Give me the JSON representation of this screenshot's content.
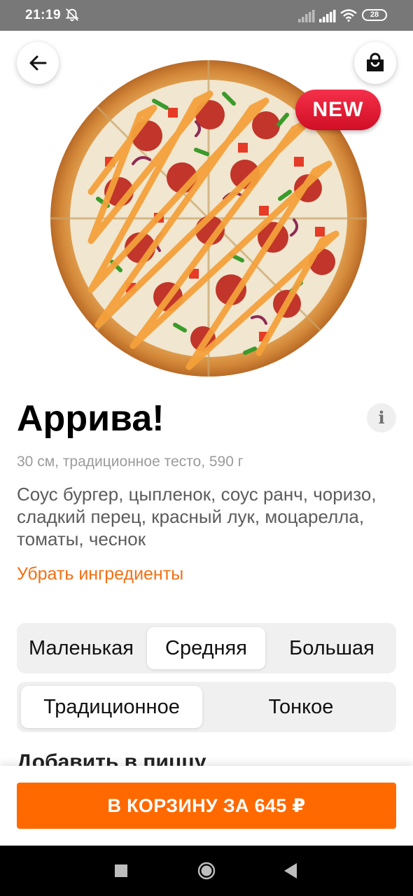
{
  "status_bar": {
    "time": "21:19",
    "battery": "28",
    "icons": [
      "mute-alarm-icon",
      "signal-icon",
      "wifi-icon",
      "battery-icon"
    ]
  },
  "header": {
    "back_icon": "arrow-left-icon",
    "cart_icon": "shopping-bag-icon"
  },
  "product": {
    "badge": "NEW",
    "name": "Аррива!",
    "info_icon_text": "i",
    "details": "30 см, традиционное тесто, 590 г",
    "ingredients": "Соус бургер, цыпленок, соус ранч, чоризо, сладкий перец, красный лук, моцарелла, томаты, чеснок",
    "remove_ingredients_label": "Убрать ингредиенты"
  },
  "size_selector": {
    "options": [
      "Маленькая",
      "Средняя",
      "Большая"
    ],
    "selected": "Средняя"
  },
  "dough_selector": {
    "options": [
      "Традиционное",
      "Тонкое"
    ],
    "selected": "Традиционное"
  },
  "add_to_pizza_heading": "Добавить в пиццу",
  "cart_button_label": "В КОРЗИНУ ЗА 645 ₽",
  "colors": {
    "accent": "#FF6900",
    "link": "#F36F12",
    "badge": "#E2162F",
    "status_bar": "#787878"
  },
  "nav_bar": {
    "icons": [
      "recent-apps-icon",
      "home-icon",
      "back-triangle-icon"
    ]
  }
}
